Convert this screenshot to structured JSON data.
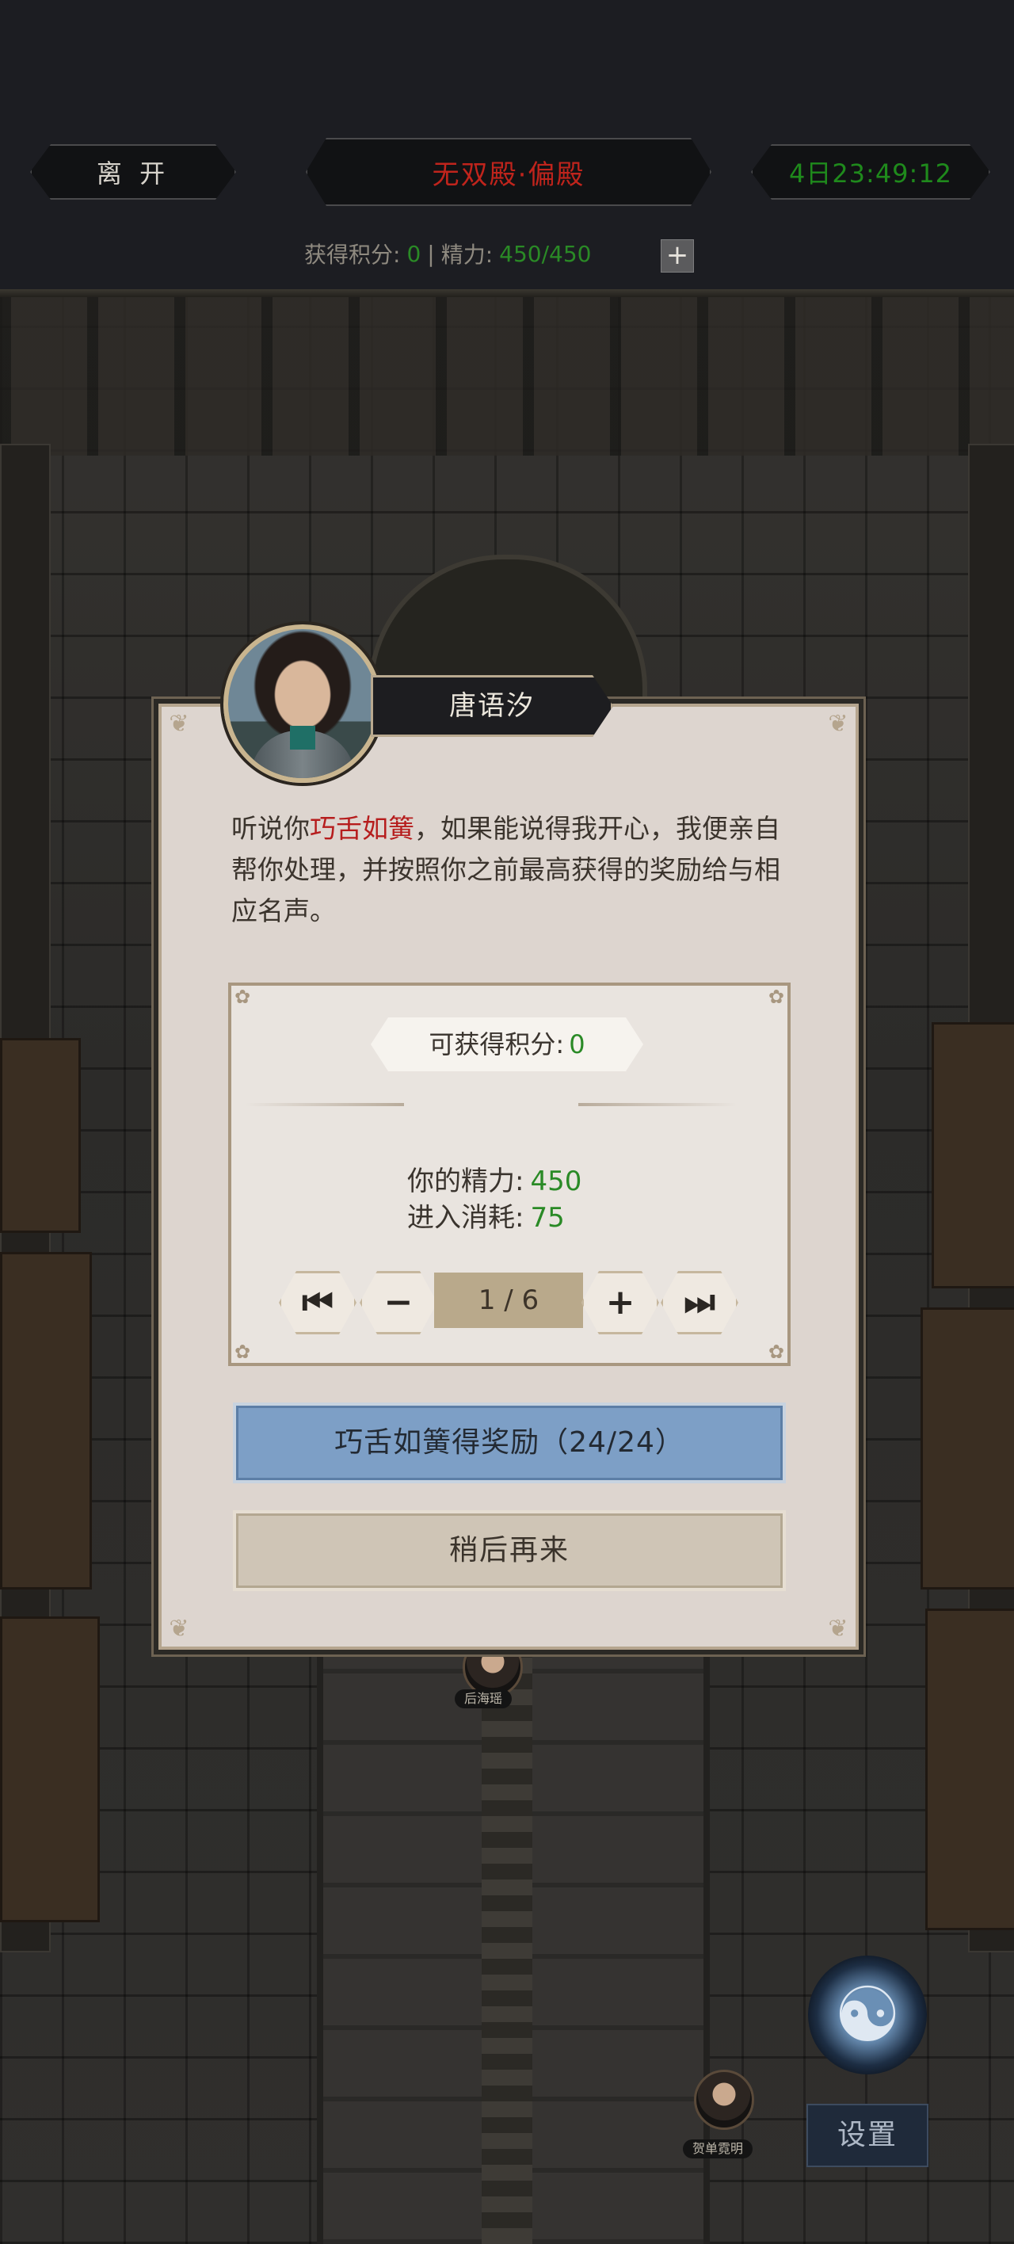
{
  "topbar": {
    "leave_label": "离 开",
    "location_title": "无双殿·偏殿",
    "timer": "4日23:49:12",
    "score_label": "获得积分:",
    "score_value": "0",
    "separator": "|",
    "energy_label": "精力:",
    "energy_value": "450/450",
    "add_icon": "plus-icon"
  },
  "dialog": {
    "npc_name": "唐语汐",
    "text_before": "听说你",
    "text_highlight": "巧舌如簧",
    "text_after": "，如果能说得我开心，我便亲自帮你处理，并按照你之前最高获得的奖励给与相应名声。",
    "reward_label": "可获得积分:",
    "reward_value": "0",
    "energy_label": "你的精力:",
    "energy_value": "450",
    "cost_label": "进入消耗:",
    "cost_value": "75",
    "pager": {
      "first_icon": "first-page-icon",
      "prev_icon": "minus-icon",
      "page_text": "1 / 6",
      "next_icon": "plus-icon",
      "last_icon": "last-page-icon"
    },
    "primary_button": "巧舌如簧得奖励（24/24）",
    "secondary_button": "稍后再来"
  },
  "scene": {
    "npc_tag_1": "后海瑶",
    "npc_tag_2": "贺单霓明",
    "settings_label": "设置",
    "yinyang_icon": "yinyang-icon"
  },
  "colors": {
    "title_red": "#c0241c",
    "timer_green": "#1f8a1c",
    "value_green": "#2a8a26",
    "highlight_red": "#b61d1d",
    "primary_blue": "#7d9fc6"
  }
}
